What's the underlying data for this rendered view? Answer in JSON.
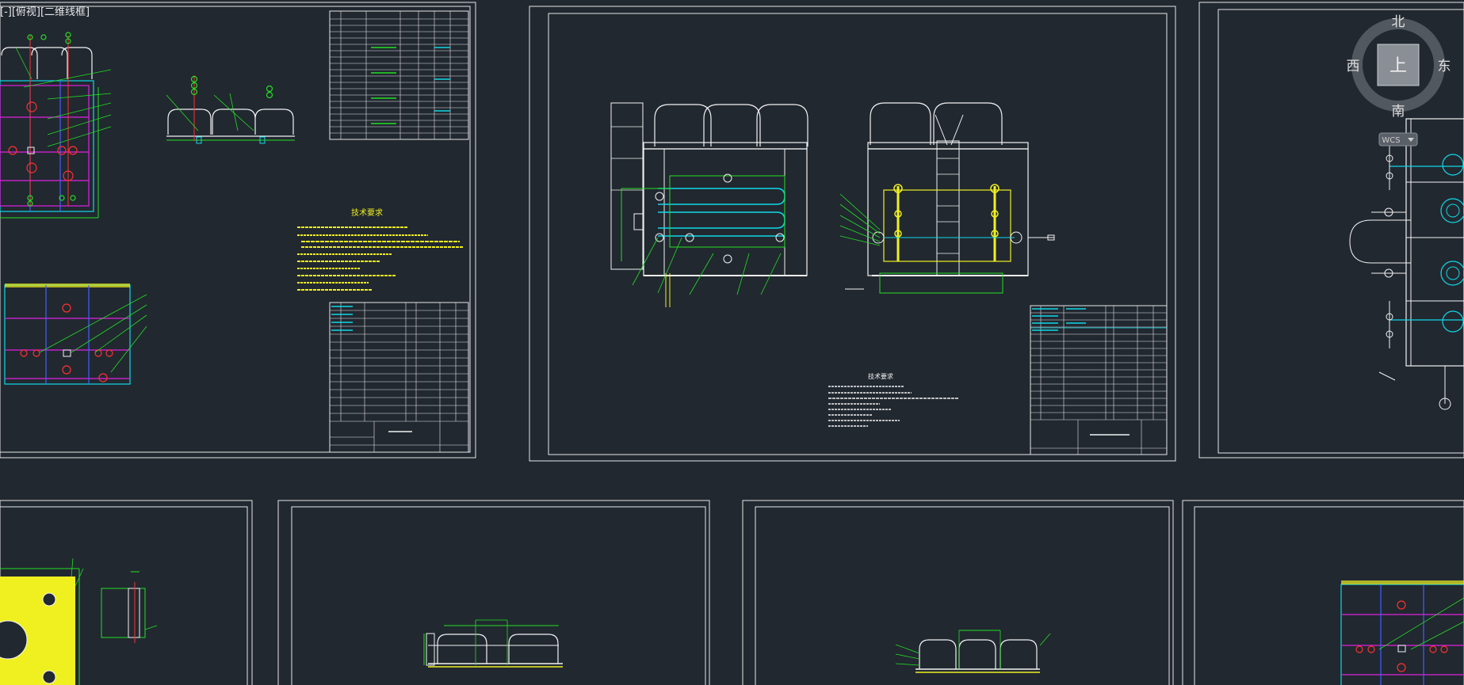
{
  "viewport": {
    "label": "[-][俯视][二维线框]"
  },
  "viewcube": {
    "north": "北",
    "south": "南",
    "east": "东",
    "west": "西",
    "top": "上",
    "wcs": "WCS"
  },
  "drawing": {
    "tech_req_title_1": "技术要求",
    "tech_req_title_2": "技术要求"
  },
  "colors": {
    "background": "#212830",
    "frame": "#e6e6e6",
    "outline": "#f2f2f2",
    "cyan": "#10d8e8",
    "green": "#22e022",
    "magenta": "#e020e0",
    "yellow": "#f0f020",
    "blue": "#4060ff",
    "red": "#ff3030"
  }
}
